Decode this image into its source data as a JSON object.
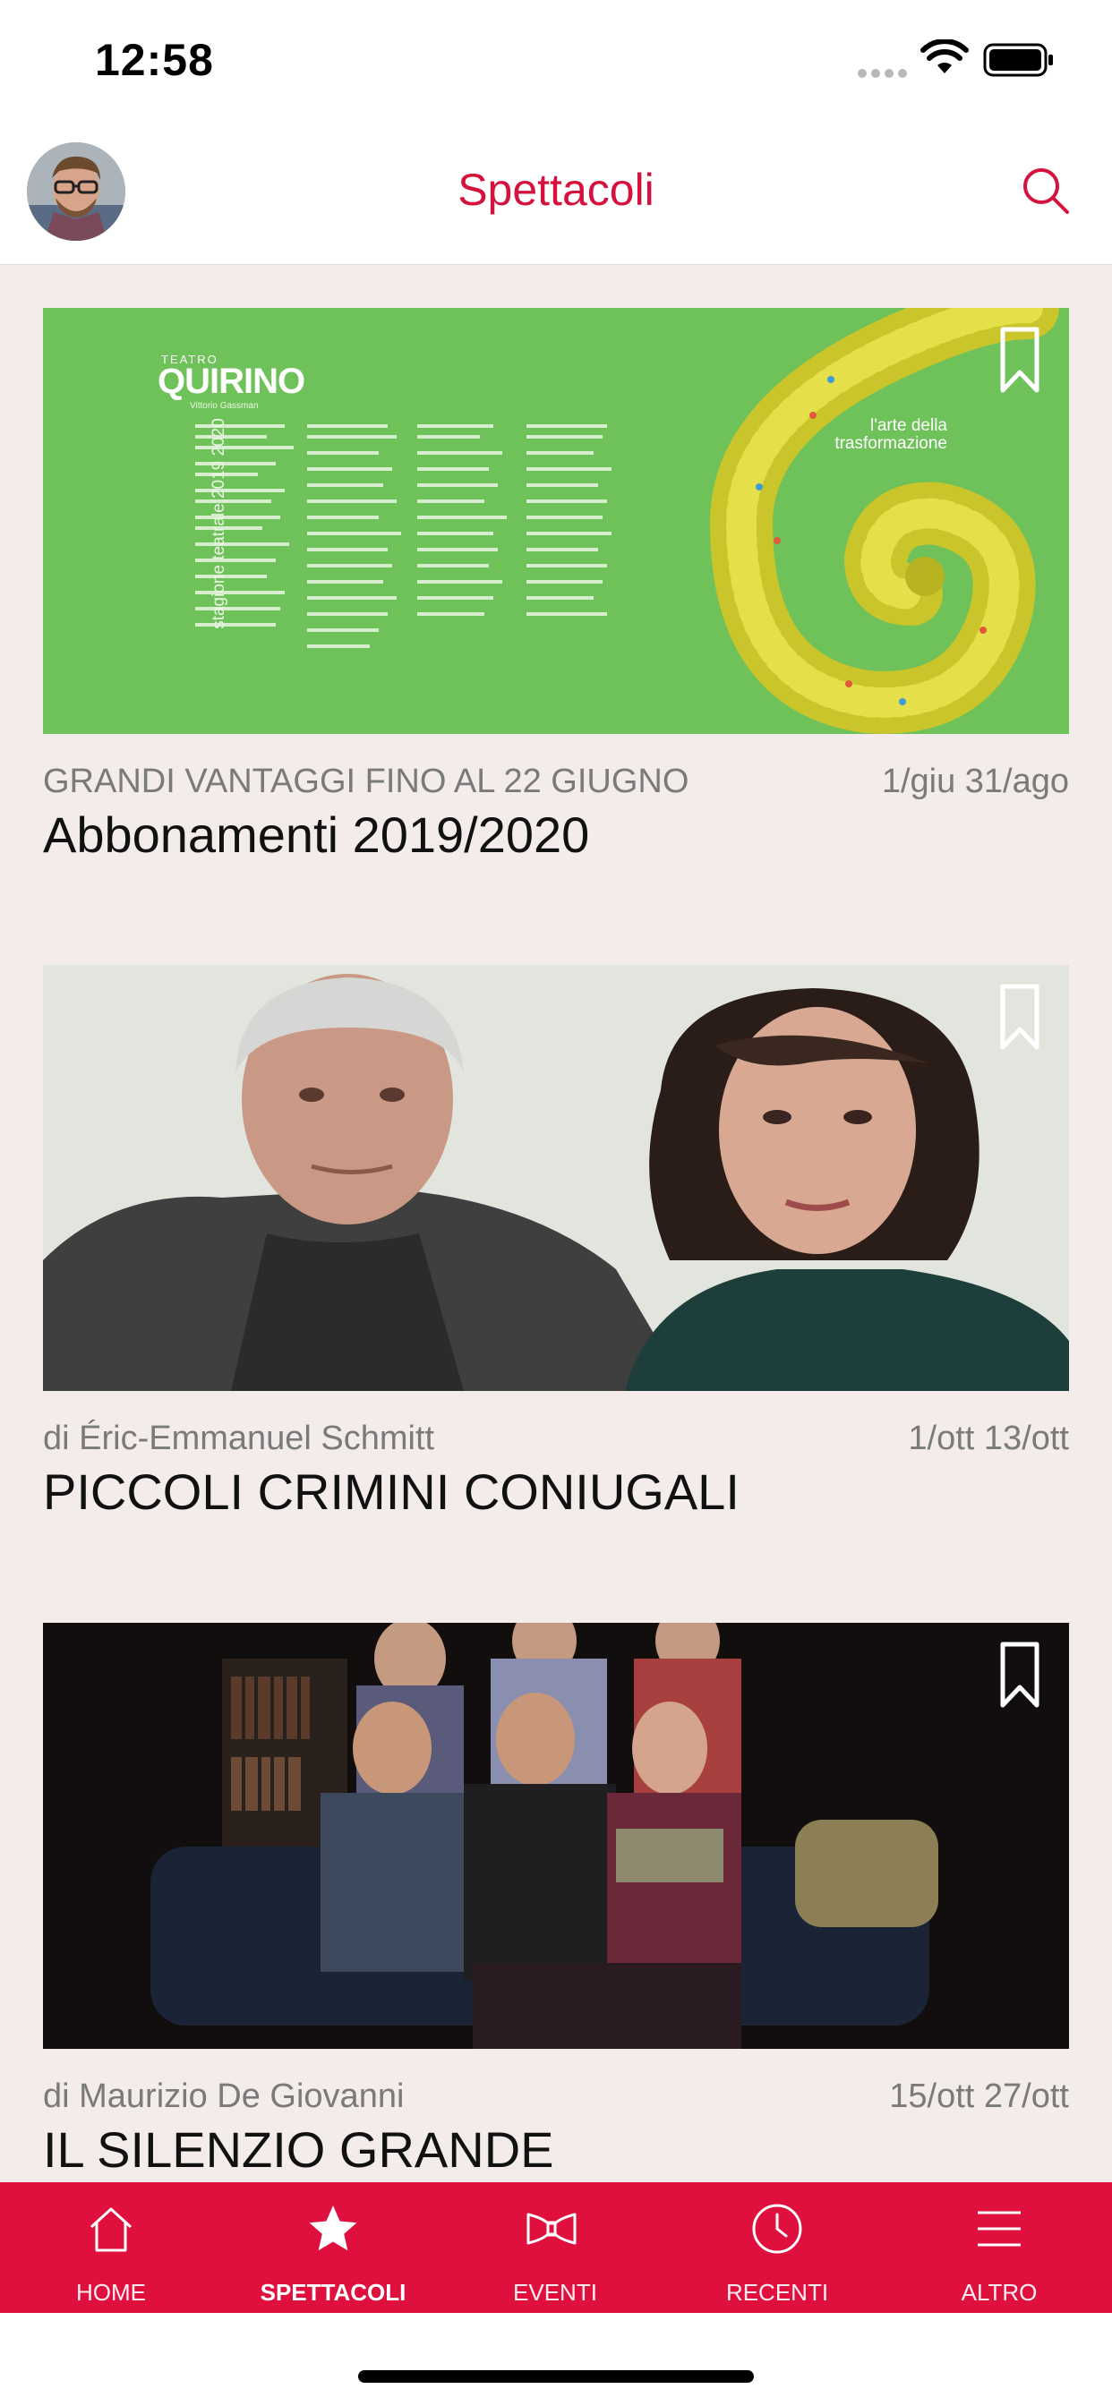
{
  "status": {
    "time": "12:58"
  },
  "header": {
    "title": "Spettacoli"
  },
  "poster": {
    "brand": "QUIRINO",
    "brand_small": "TEATRO",
    "brand_sub": "Vittorio Gassman",
    "season": "stagione teatrale 2019 2020",
    "tagline": "l'arte della trasformazione"
  },
  "cards": [
    {
      "subtitle": "GRANDI VANTAGGI FINO AL 22 GIUGNO",
      "dates": "1/giu 31/ago",
      "title": "Abbonamenti 2019/2020"
    },
    {
      "subtitle": "di Éric-Emmanuel Schmitt",
      "dates": "1/ott 13/ott",
      "title": "PICCOLI CRIMINI CONIUGALI"
    },
    {
      "subtitle": "di Maurizio De Giovanni",
      "dates": "15/ott 27/ott",
      "title": "IL SILENZIO GRANDE"
    }
  ],
  "tabs": [
    {
      "label": "HOME",
      "icon": "home-icon",
      "active": false
    },
    {
      "label": "SPETTACOLI",
      "icon": "star-icon",
      "active": true
    },
    {
      "label": "EVENTI",
      "icon": "bowtie-icon",
      "active": false
    },
    {
      "label": "RECENTI",
      "icon": "clock-icon",
      "active": false
    },
    {
      "label": "ALTRO",
      "icon": "menu-icon",
      "active": false
    }
  ],
  "colors": {
    "accent": "#d5123e",
    "tab_bar": "#df0f3e",
    "background": "#f3ecea",
    "poster_green": "#6fc15a"
  }
}
